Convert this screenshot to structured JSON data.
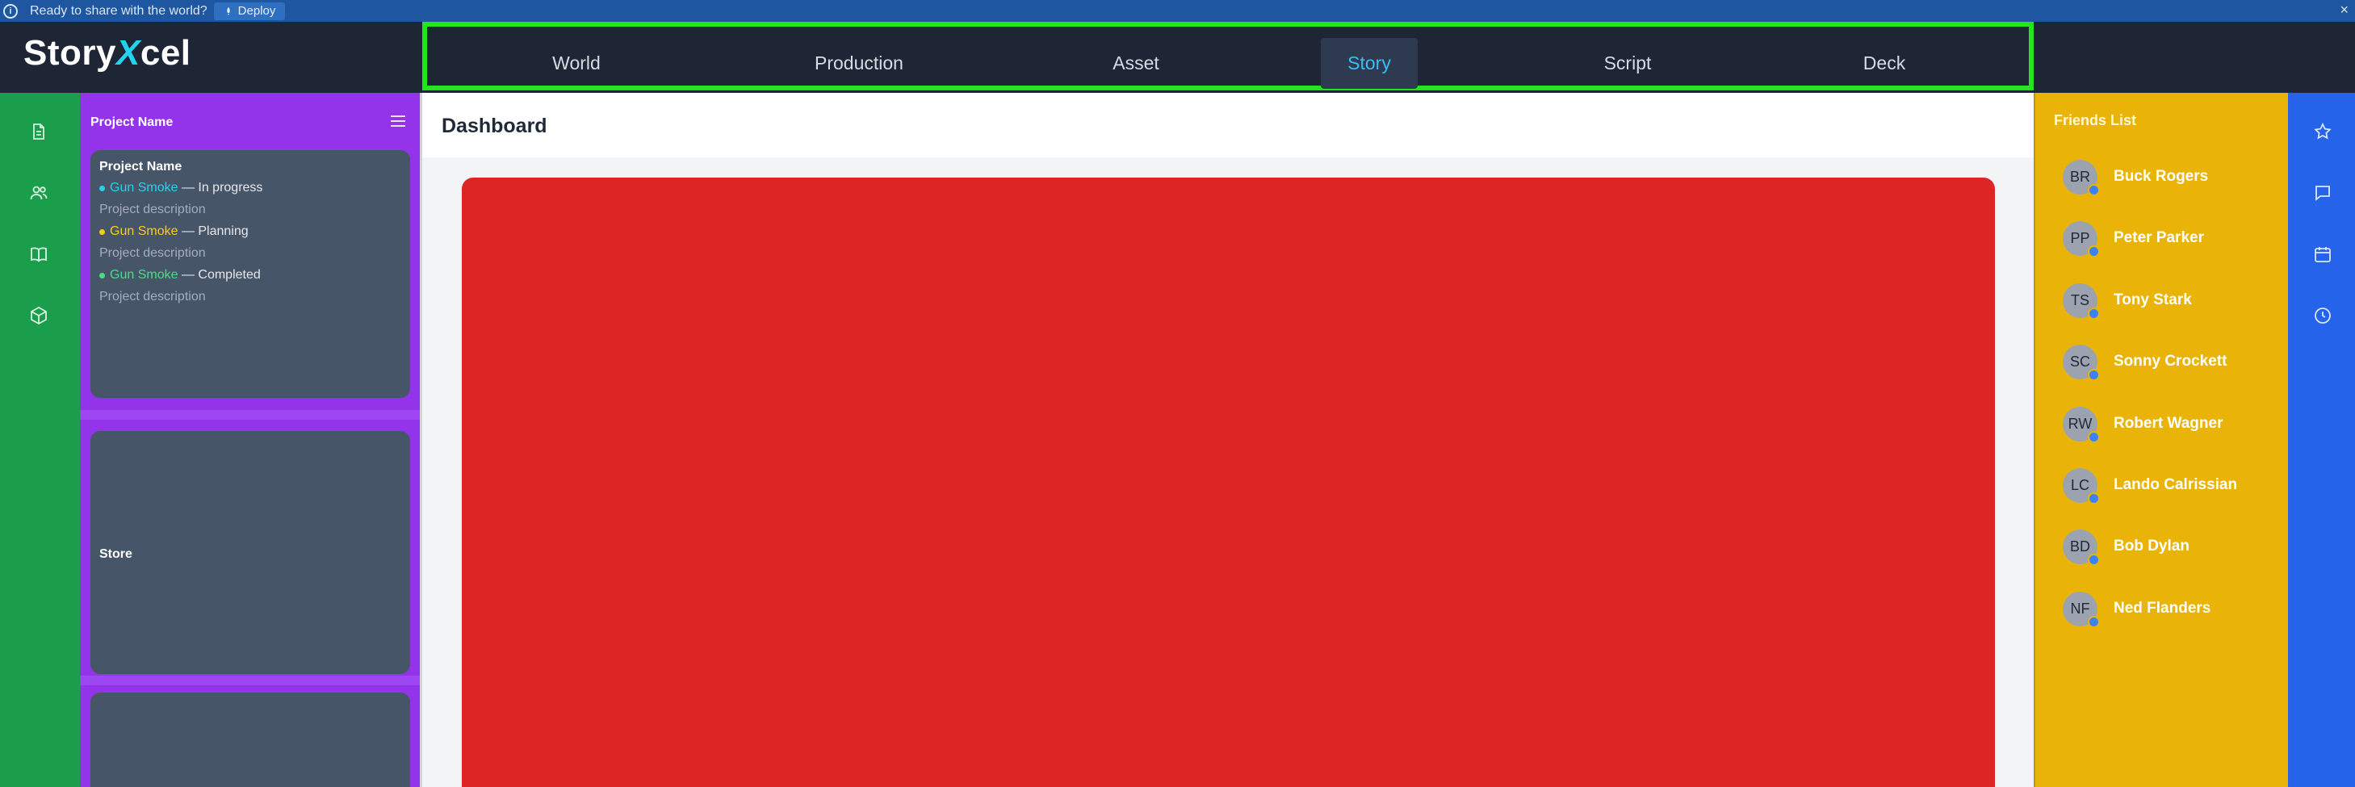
{
  "banner": {
    "message": "Ready to share with the world?",
    "deploy_label": "Deploy",
    "close_glyph": "×"
  },
  "header": {
    "logo_part1": "Story",
    "logo_x": "X",
    "logo_part2": "cel",
    "nav": [
      {
        "label": "World"
      },
      {
        "label": "Production"
      },
      {
        "label": "Asset"
      },
      {
        "label": "Story",
        "active": true
      },
      {
        "label": "Script"
      },
      {
        "label": "Deck"
      }
    ]
  },
  "left_rail": {
    "icons": [
      "document-icon",
      "users-icon",
      "book-icon",
      "cube-icon"
    ]
  },
  "projects": {
    "header": "Project Name",
    "card": {
      "title": "Project Name",
      "items": [
        {
          "name": "Gun Smoke",
          "status": "— In progress",
          "color": "#22d3ee",
          "description": "Project description"
        },
        {
          "name": "Gun Smoke",
          "status": "— Planning",
          "color": "#facc15",
          "description": "Project description"
        },
        {
          "name": "Gun Smoke",
          "status": "— Completed",
          "color": "#4ade80",
          "description": "Project description"
        }
      ]
    },
    "store_label": "Store"
  },
  "main": {
    "title": "Dashboard",
    "panel_color": "#dc2626"
  },
  "friends": {
    "header": "Friends List",
    "list": [
      {
        "initials": "BR",
        "name": "Buck Rogers"
      },
      {
        "initials": "PP",
        "name": "Peter Parker"
      },
      {
        "initials": "TS",
        "name": "Tony Stark"
      },
      {
        "initials": "SC",
        "name": "Sonny Crockett"
      },
      {
        "initials": "RW",
        "name": "Robert Wagner"
      },
      {
        "initials": "LC",
        "name": "Lando Calrissian"
      },
      {
        "initials": "BD",
        "name": "Bob Dylan"
      },
      {
        "initials": "NF",
        "name": "Ned Flanders"
      }
    ]
  },
  "right_rail": {
    "icons": [
      "star-icon",
      "chat-icon",
      "calendar-icon",
      "clock-icon"
    ]
  },
  "colors": {
    "nav_highlight_border": "#22e61b",
    "active_nav_text": "#38bdf8",
    "left_rail": "#1a9e4b",
    "project_sidebar": "#9333ea",
    "friends_panel": "#eab308",
    "right_rail": "#2563eb"
  }
}
